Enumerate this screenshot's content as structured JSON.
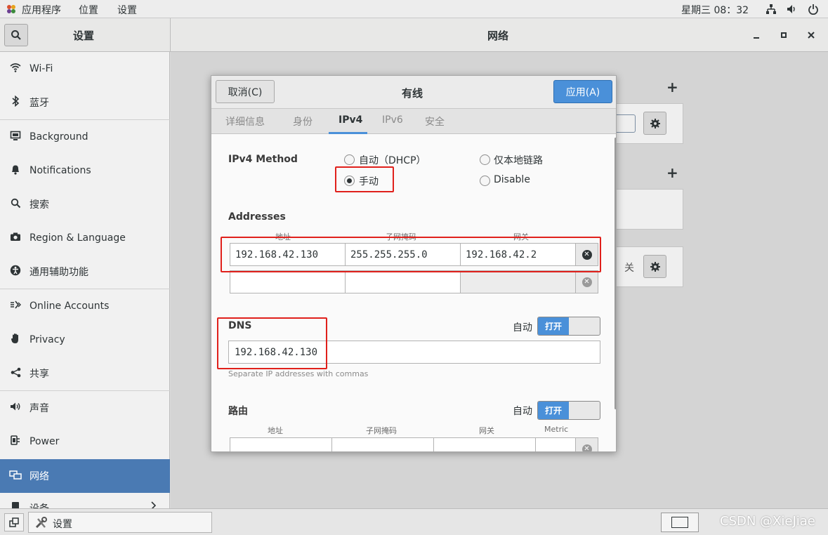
{
  "topbar": {
    "menus": [
      "应用程序",
      "位置",
      "设置"
    ],
    "clock": "星期三 08：32"
  },
  "titlebar": {
    "left_title": "设置",
    "title": "网络"
  },
  "sidebar": {
    "items": [
      {
        "label": "Wi-Fi",
        "icon": "wifi-icon"
      },
      {
        "label": "蓝牙",
        "icon": "bluetooth-icon"
      },
      {
        "label": "Background",
        "icon": "monitor-icon"
      },
      {
        "label": "Notifications",
        "icon": "bell-icon"
      },
      {
        "label": "搜索",
        "icon": "search-icon"
      },
      {
        "label": "Region & Language",
        "icon": "camera-icon"
      },
      {
        "label": "通用辅助功能",
        "icon": "accessibility-icon"
      },
      {
        "label": "Online Accounts",
        "icon": "online-accounts-icon"
      },
      {
        "label": "Privacy",
        "icon": "hand-icon"
      },
      {
        "label": "共享",
        "icon": "share-icon"
      },
      {
        "label": "声音",
        "icon": "speaker-icon"
      },
      {
        "label": "Power",
        "icon": "power-plug-icon"
      },
      {
        "label": "网络",
        "icon": "network-icon"
      },
      {
        "label": "设备",
        "icon": "devices-icon"
      }
    ]
  },
  "content": {
    "plus_label": "+",
    "card3_text": "关"
  },
  "dialog": {
    "title": "有线",
    "cancel_label": "取消(C)",
    "apply_label": "应用(A)",
    "tabs": [
      "详细信息",
      "身份",
      "IPv4",
      "IPv6",
      "安全"
    ],
    "active_tab": "IPv4",
    "method_label": "IPv4 Method",
    "methods": {
      "dhcp": "自动（DHCP）",
      "manual": "手动",
      "link_local": "仅本地链路",
      "disable": "Disable"
    },
    "selected_method": "manual",
    "addresses": {
      "label": "Addresses",
      "headers": [
        "地址",
        "子网掩码",
        "网关"
      ],
      "rows": [
        [
          "192.168.42.130",
          "255.255.255.0",
          "192.168.42.2"
        ],
        [
          "",
          "",
          ""
        ]
      ]
    },
    "dns": {
      "label": "DNS",
      "auto_label": "自动",
      "toggle_label": "打开",
      "value": "192.168.42.130",
      "hint": "Separate IP addresses with commas"
    },
    "routes": {
      "label": "路由",
      "auto_label": "自动",
      "toggle_label": "打开",
      "headers": [
        "地址",
        "子网掩码",
        "网关",
        "Metric"
      ]
    }
  },
  "taskbar": {
    "task_label": "设置",
    "watermark": "CSDN @XieJiae"
  },
  "colors": {
    "accent": "#4a90d9",
    "sidebar_selected": "#4a7ab3",
    "highlight_red": "#e0201b"
  }
}
